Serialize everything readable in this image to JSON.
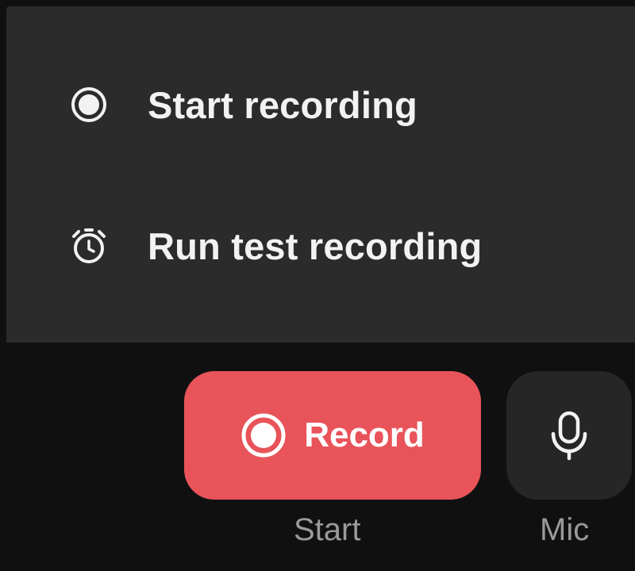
{
  "menu": {
    "items": [
      {
        "label": "Start recording",
        "icon": "record-circle-icon"
      },
      {
        "label": "Run test recording",
        "icon": "stopwatch-icon"
      }
    ]
  },
  "toolbar": {
    "record_button": {
      "label": "Record",
      "icon": "record-circle-icon",
      "color": "#e8545a"
    },
    "record_caption": "Start",
    "mic_button": {
      "icon": "microphone-icon"
    },
    "mic_caption": "Mic"
  },
  "colors": {
    "menu_background": "#2b2b2b",
    "toolbar_background": "#101010",
    "accent": "#e8545a",
    "caption_text": "#9a9a9a"
  }
}
